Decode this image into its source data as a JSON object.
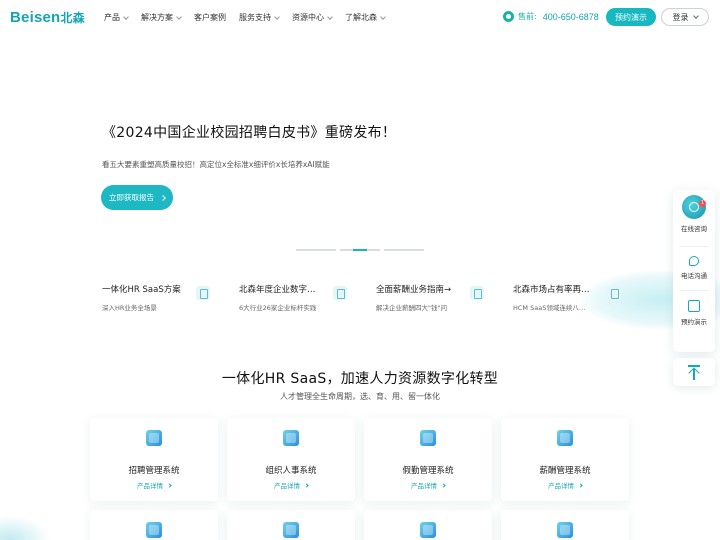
{
  "brand": {
    "logo_en": "Beisen",
    "logo_cn": "北森"
  },
  "nav": {
    "items": [
      "产品",
      "解决方案",
      "客户案例",
      "服务支持",
      "资源中心",
      "了解北森"
    ],
    "has_dropdown": [
      true,
      true,
      false,
      true,
      true,
      true
    ],
    "phone_label": "售前:",
    "phone_number": "400-650-6878",
    "demo_button": "预约演示",
    "login_button": "登录"
  },
  "hero": {
    "title": "《2024中国企业校园招聘白皮书》重磅发布！",
    "subtitle": "看五大要素重塑高质量校招！高定位x全标准x细评价x长培养xAI赋能",
    "cta": "立即获取报告",
    "slides_count": 3,
    "active_slide": 1
  },
  "features": [
    {
      "title": "一体化HR SaaS方案",
      "desc": "深入HR业务全场景"
    },
    {
      "title": "北森年度企业数字…",
      "desc": "6大行业26家企业标杆实践"
    },
    {
      "title": "全面薪酬业务指南→",
      "desc": "解决企业薪酬四大\"钱\"问"
    },
    {
      "title": "北森市场占有率再…",
      "desc": "HCM SaaS领域连续八…"
    }
  ],
  "section": {
    "title": "一体化HR SaaS，加速人力资源数字化转型",
    "subtitle": "人才管理全生命周期，选、育、用、留一体化"
  },
  "products": [
    {
      "title": "招聘管理系统",
      "link": "产品详情"
    },
    {
      "title": "组织人事系统",
      "link": "产品详情"
    },
    {
      "title": "假勤管理系统",
      "link": "产品详情"
    },
    {
      "title": "薪酬管理系统",
      "link": "产品详情"
    }
  ],
  "widget": {
    "chat_label": "在线咨询",
    "chat_badge": "1",
    "phone_label": "电话沟通",
    "demo_label": "预约演示"
  },
  "colors": {
    "accent": "#17b8c0",
    "brand": "#15a4b4"
  }
}
